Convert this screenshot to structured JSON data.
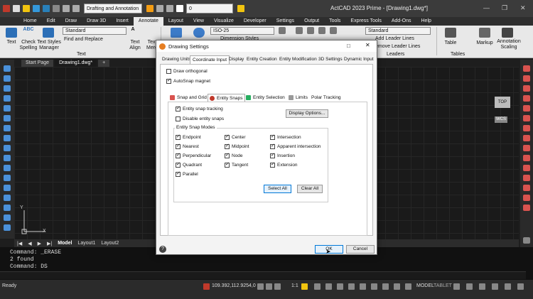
{
  "qat": {
    "workspace": "Drafting and Annotation",
    "layer": "0"
  },
  "app_title": "ActCAD 2023 Prime - [Drawing1.dwg*]",
  "window_controls": [
    "—",
    "❐",
    "✕"
  ],
  "menu_tabs": [
    "Home",
    "Edit",
    "Draw",
    "Draw 3D",
    "Insert",
    "Annotate",
    "Layout",
    "View",
    "Visualize",
    "Developer",
    "Settings",
    "Output",
    "Tools",
    "Express Tools",
    "Add-Ons",
    "Help"
  ],
  "active_tab": "Annotate",
  "ribbon": {
    "text_btn": "Text",
    "abc": "ABC",
    "check_spelling": "Check\nSpelling",
    "text_styles_manager": "Text Styles\nManager",
    "text_style_combo": "Standard",
    "find_replace": "Find and Replace",
    "text_align": "Text\nAlign",
    "text_merge": "Text\nMerg",
    "dim_style_combo": "ISO-25",
    "dim_styles_manager": "Dimension Styles Manager",
    "leader_style_combo": "Standard",
    "add_leader_lines": "Add Leader Lines",
    "remove_leader_lines": "emove Leader Lines",
    "leaders_label": "Leaders",
    "table": "Table",
    "tables_label": "Tables",
    "markup": "Markup",
    "annotation_scaling": "Annotation\nScaling",
    "text_panel_label": "Text"
  },
  "doc_tabs": [
    "Start Page",
    "Drawing1.dwg*"
  ],
  "layout_tabs": [
    "Model",
    "Layout1",
    "Layout2"
  ],
  "viewcube": {
    "top": "TOP",
    "wcs": "WCS"
  },
  "ucs": {
    "x": "X",
    "y": "Y"
  },
  "command_lines": [
    "Command: _ERASE",
    "2 found",
    "Command: DS"
  ],
  "status": {
    "ready": "Ready",
    "coords": "109.392,112.9254,0",
    "scale": "1:1",
    "model": "MODEL",
    "tablet": "TABLET"
  },
  "dialog": {
    "title": "Drawing Settings",
    "close": "✕",
    "tabs": [
      "Drawing Units",
      "Coordinate Input",
      "Display",
      "Entity Creation",
      "Entity Modification",
      "3D Settings",
      "Dynamic Input"
    ],
    "active_tab": "Coordinate Input",
    "draw_orthogonal": "Draw orthogonal",
    "autosnap_magnet": "AutoSnap magnet",
    "subtabs": [
      "Snap and Grid",
      "Entity Snaps",
      "Entity Selection",
      "Limits",
      "Polar Tracking"
    ],
    "active_subtab": "Entity Snaps",
    "entity_snap_tracking": "Entity snap tracking",
    "disable_entity_snaps": "Disable entity snaps",
    "display_options": "Display Options...",
    "snap_modes_label": "Entity Snap Modes",
    "snap_modes": [
      [
        "Endpoint",
        "Center",
        "Intersection"
      ],
      [
        "Nearest",
        "Midpoint",
        "Apparent intersection"
      ],
      [
        "Perpendicular",
        "Node",
        "Insertion"
      ],
      [
        "Quadrant",
        "Tangent",
        "Extension"
      ],
      [
        "Parallel",
        "",
        ""
      ]
    ],
    "select_all": "Select All",
    "clear_all": "Clear All",
    "help": "?",
    "ok": "OK",
    "cancel": "Cancel"
  },
  "colors": {
    "accent": "#0078d7",
    "ribbon_bg": "#e8e8e8",
    "canvas_bg": "#1a1a1a",
    "dialog_bg": "#f3f3f3"
  }
}
